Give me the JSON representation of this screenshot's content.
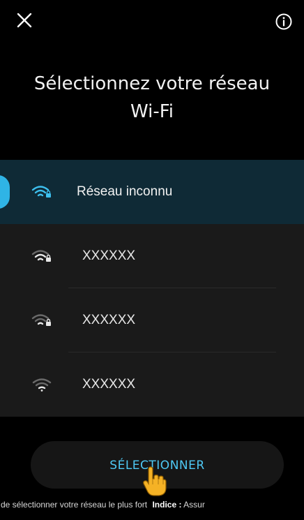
{
  "header": {
    "close_icon": "close-icon",
    "info_icon": "info-icon"
  },
  "title": "Sélectionnez votre réseau Wi-Fi",
  "colors": {
    "accent": "#2fb4e6",
    "button_text": "#4ec8f3",
    "selected_row": "#0f2a36",
    "list_background": "#1a1a1a"
  },
  "networks": [
    {
      "label": "Réseau inconnu",
      "icon": "wifi-locked-icon",
      "selected": true
    },
    {
      "label": "XXXXXX",
      "icon": "wifi-locked-icon",
      "selected": false
    },
    {
      "label": "XXXXXX",
      "icon": "wifi-locked-icon",
      "selected": false
    },
    {
      "label": "XXXXXX",
      "icon": "wifi-icon",
      "selected": false
    }
  ],
  "select_button": {
    "label": "SÉLECTIONNER",
    "cursor_icon": "hand-pointer-icon"
  },
  "hint": {
    "prefix": "de sélectionner votre réseau le plus fort",
    "label": "Indice :",
    "suffix": "Assur"
  }
}
